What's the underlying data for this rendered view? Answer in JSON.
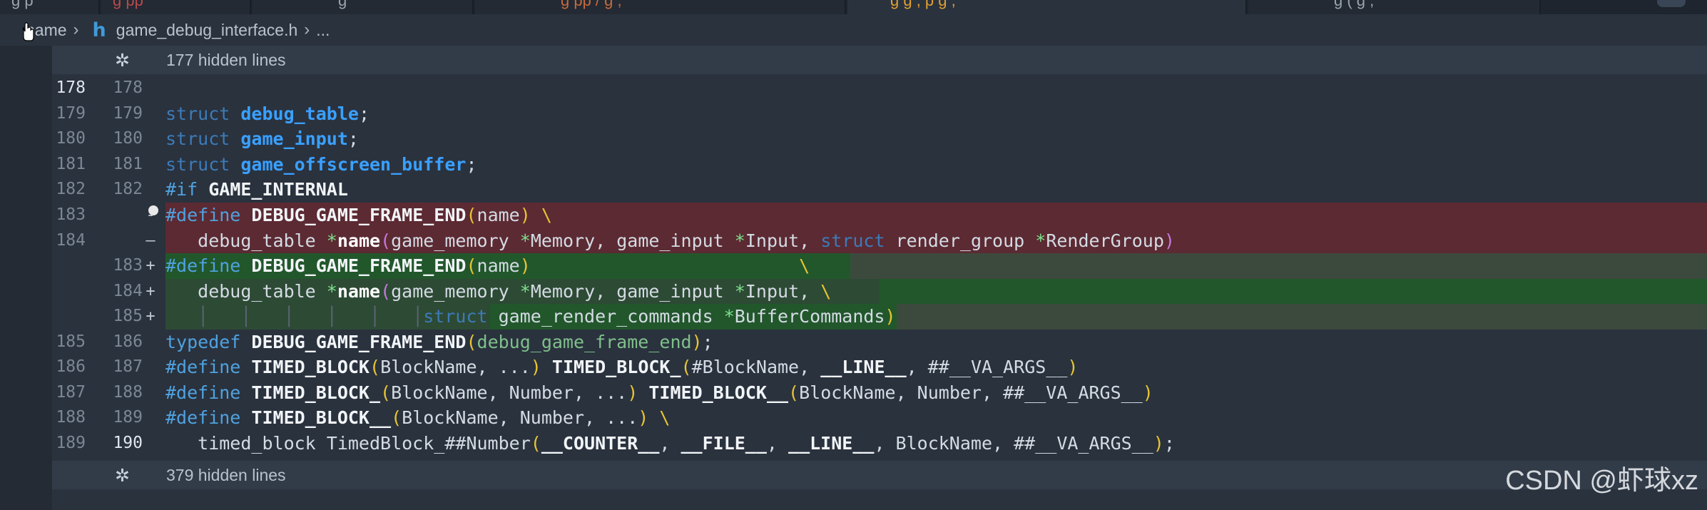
{
  "tabs": [
    {
      "text": "g    p",
      "color": "#9aa4ae"
    },
    {
      "text": "g        pp",
      "color": "#b94a4a"
    },
    {
      "text": "    g",
      "color": "#9aa4ae"
    },
    {
      "text": "   g   pp /      g    ,",
      "color": "#c96a3a"
    },
    {
      "text": "",
      "color": "#9aa4ae"
    },
    {
      "text": "    g   g  ,  p   g    ,",
      "color": "#e0a030"
    },
    {
      "text": "    g   (  g   ,",
      "color": "#9aa4ae"
    }
  ],
  "breadcrumb": {
    "root": "name",
    "file_icon": "h",
    "file": "game_debug_interface.h",
    "more": "..."
  },
  "folds": {
    "top": {
      "icon": "fold-expand-icon",
      "text": "177 hidden lines"
    },
    "bottom": {
      "icon": "fold-expand-icon",
      "text": "379 hidden lines"
    }
  },
  "lines": [
    {
      "old": "178",
      "new": "178"
    },
    {
      "old": "179",
      "new": "179"
    },
    {
      "old": "180",
      "new": "180"
    },
    {
      "old": "181",
      "new": "181"
    },
    {
      "old": "182",
      "new": "182"
    },
    {
      "old": "183",
      "new": "",
      "marker": "-"
    },
    {
      "old": "184",
      "new": "",
      "marker": "—"
    },
    {
      "old": "",
      "new": "183",
      "marker": "+"
    },
    {
      "old": "",
      "new": "184",
      "marker": "+"
    },
    {
      "old": "",
      "new": "185",
      "marker": "+"
    },
    {
      "old": "185",
      "new": "186"
    },
    {
      "old": "186",
      "new": "187"
    },
    {
      "old": "187",
      "new": "188"
    },
    {
      "old": "188",
      "new": "189"
    },
    {
      "old": "189",
      "new": "190"
    }
  ],
  "code": {
    "l179": [
      "struct",
      "debug_table",
      ";"
    ],
    "l180": [
      "struct",
      "game_input",
      ";"
    ],
    "l181": [
      "struct",
      "game_offscreen_buffer",
      ";"
    ],
    "l182": [
      "#if",
      "GAME_INTERNAL"
    ],
    "l183d": [
      "#define",
      "DEBUG_GAME_FRAME_END",
      "(",
      "name",
      ")",
      " \\"
    ],
    "l184d": [
      "debug_table ",
      "*",
      "name",
      "(",
      "game_memory ",
      "*",
      "Memory, game_input ",
      "*",
      "Input, ",
      "struct",
      " render_group ",
      "*",
      "RenderGroup",
      ")"
    ],
    "l183a": [
      "#define",
      "DEBUG_GAME_FRAME_END",
      "(",
      "name",
      ")",
      "\\"
    ],
    "l184a": [
      "debug_table ",
      "*",
      "name",
      "(",
      "game_memory ",
      "*",
      "Memory, game_input ",
      "*",
      "Input, ",
      "\\"
    ],
    "l185a": [
      "struct",
      "game_render_commands ",
      "*",
      "BufferCommands",
      ")"
    ],
    "l186": [
      "typedef",
      "DEBUG_GAME_FRAME_END",
      "(",
      "debug_game_frame_end",
      ")",
      ";"
    ],
    "l187": [
      "#define",
      "TIMED_BLOCK",
      "(",
      "BlockName, ...",
      ")",
      "TIMED_BLOCK_",
      "(",
      "#BlockName, ",
      "__LINE__",
      ", ##__VA_ARGS__",
      ")"
    ],
    "l188": [
      "#define",
      "TIMED_BLOCK_",
      "(",
      "BlockName, Number, ...",
      ")",
      "TIMED_BLOCK__",
      "(",
      "BlockName, Number, ##__VA_ARGS__",
      ")"
    ],
    "l189": [
      "#define",
      "TIMED_BLOCK__",
      "(",
      "BlockName, Number, ...",
      ")",
      " \\"
    ],
    "l190": [
      "timed_block TimedBlock_##Number",
      "(",
      "__COUNTER__",
      ", ",
      "__FILE__",
      ", ",
      "__LINE__",
      ", BlockName, ##__VA_ARGS__",
      ")",
      ";"
    ]
  },
  "watermark": "CSDN @虾球xz",
  "colors": {
    "deleted": "#5c2a33",
    "added": "#22572c",
    "keyword": "#3c7bb8",
    "type": "#3aa0ff",
    "paren": "#e8c531"
  }
}
